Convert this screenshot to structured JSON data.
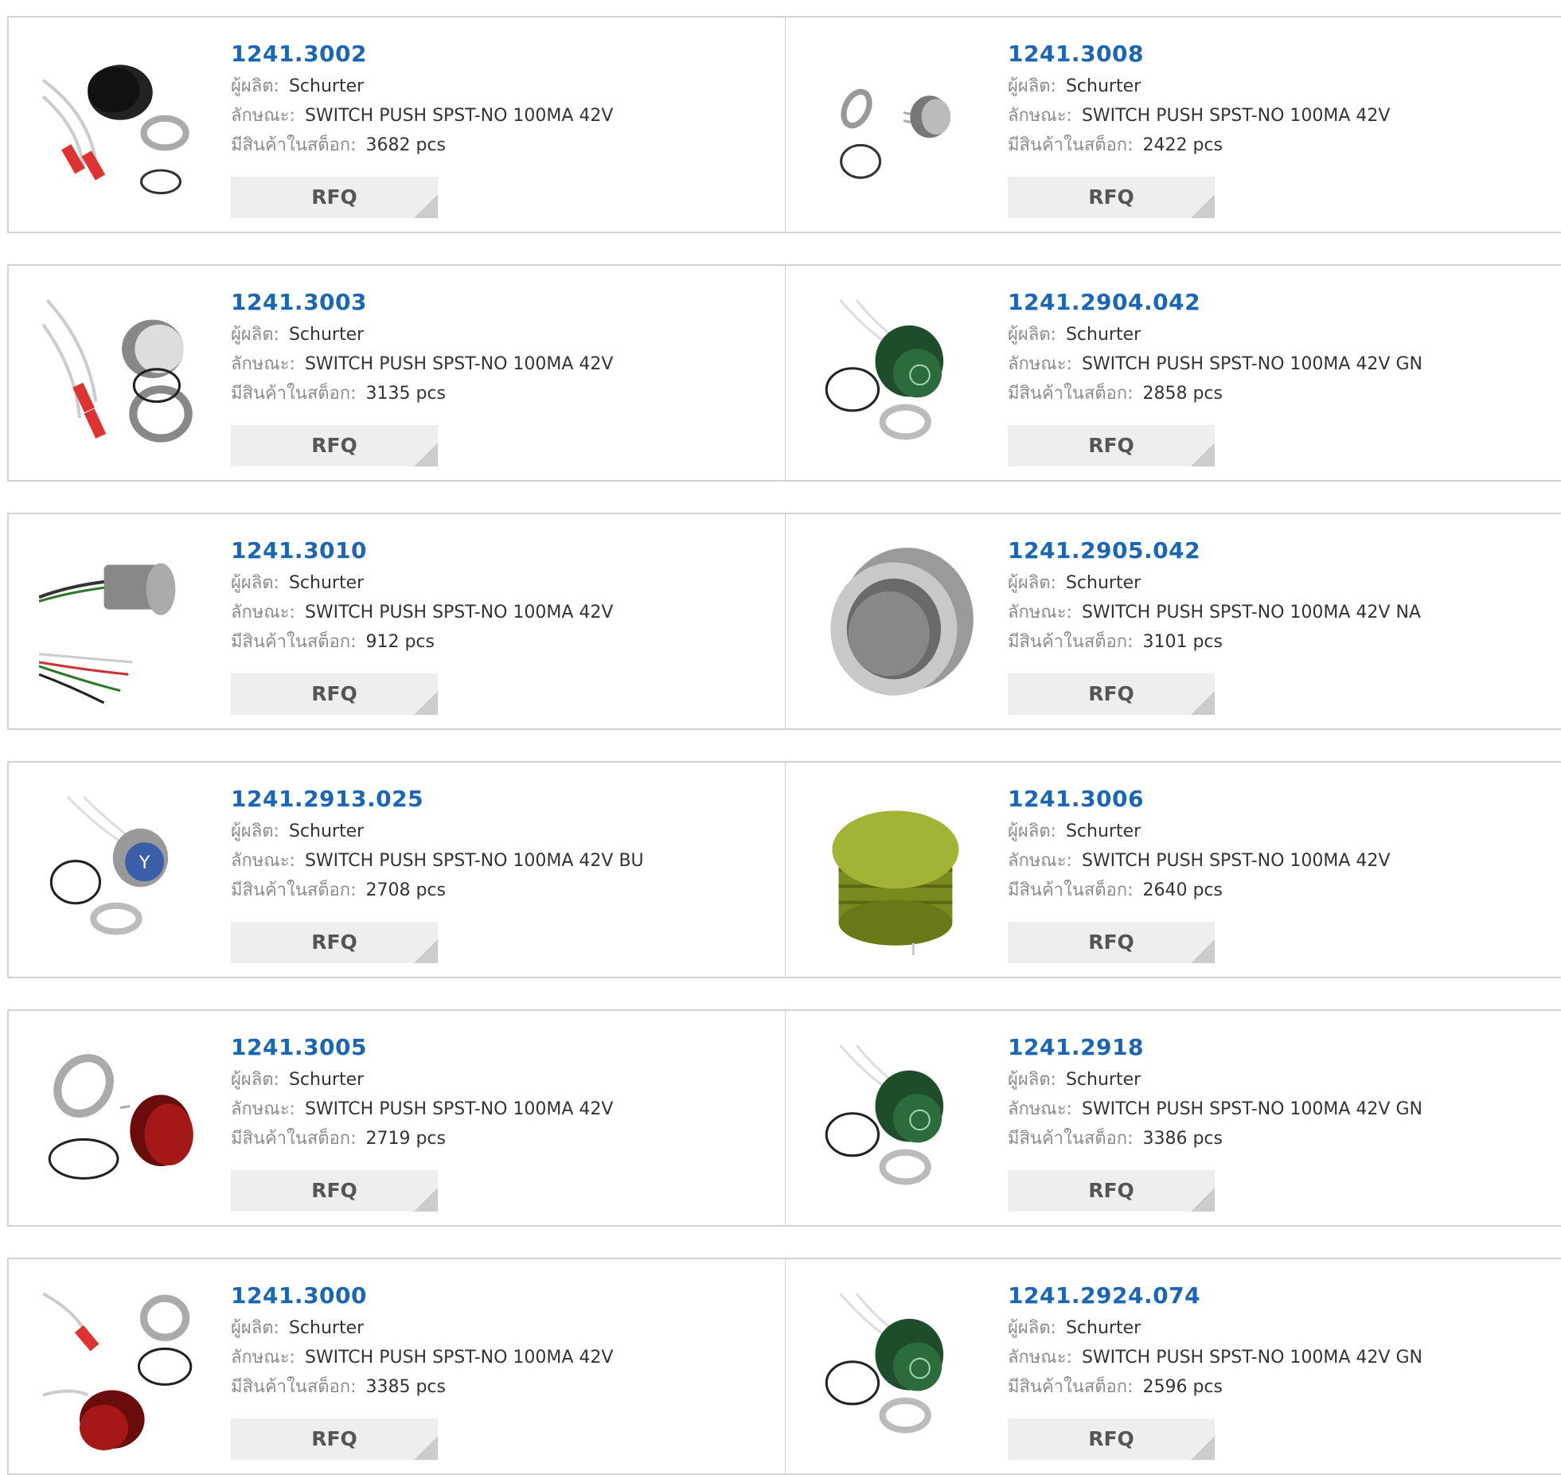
{
  "labels": {
    "manufacturer": "ผู้ผลิต:",
    "description": "ลักษณะ:",
    "stock": "มีสินค้าในสต็อก:",
    "rfq": "RFQ"
  },
  "rows": [
    [
      {
        "part": "1241.3002",
        "manufacturer": "Schurter",
        "description": "SWITCH PUSH SPST-NO 100MA 42V",
        "stock": "3682 pcs",
        "image_icon": "black-push-button-with-wires-icon"
      },
      {
        "part": "1241.3008",
        "manufacturer": "Schurter",
        "description": "SWITCH PUSH SPST-NO 100MA 42V",
        "stock": "2422 pcs",
        "image_icon": "small-steel-push-button-icon"
      }
    ],
    [
      {
        "part": "1241.3003",
        "manufacturer": "Schurter",
        "description": "SWITCH PUSH SPST-NO 100MA 42V",
        "stock": "3135 pcs",
        "image_icon": "silver-push-button-with-wires-icon"
      },
      {
        "part": "1241.2904.042",
        "manufacturer": "Schurter",
        "description": "SWITCH PUSH SPST-NO 100MA 42V GN",
        "stock": "2858 pcs",
        "image_icon": "green-power-push-button-icon"
      }
    ],
    [
      {
        "part": "1241.3010",
        "manufacturer": "Schurter",
        "description": "SWITCH PUSH SPST-NO 100MA 42V",
        "stock": "912 pcs",
        "image_icon": "steel-push-button-side-view-icon"
      },
      {
        "part": "1241.2905.042",
        "manufacturer": "Schurter",
        "description": "SWITCH PUSH SPST-NO 100MA 42V NA",
        "stock": "3101 pcs",
        "image_icon": "large-steel-push-button-icon"
      }
    ],
    [
      {
        "part": "1241.2913.025",
        "manufacturer": "Schurter",
        "description": "SWITCH PUSH SPST-NO 100MA 42V BU",
        "stock": "2708 pcs",
        "image_icon": "blue-symbol-push-button-icon"
      },
      {
        "part": "1241.3006",
        "manufacturer": "Schurter",
        "description": "SWITCH PUSH SPST-NO 100MA 42V",
        "stock": "2640 pcs",
        "image_icon": "olive-push-button-icon"
      }
    ],
    [
      {
        "part": "1241.3005",
        "manufacturer": "Schurter",
        "description": "SWITCH PUSH SPST-NO 100MA 42V",
        "stock": "2719 pcs",
        "image_icon": "red-push-button-icon"
      },
      {
        "part": "1241.2918",
        "manufacturer": "Schurter",
        "description": "SWITCH PUSH SPST-NO 100MA 42V GN",
        "stock": "3386 pcs",
        "image_icon": "green-power-push-button-icon"
      }
    ],
    [
      {
        "part": "1241.3000",
        "manufacturer": "Schurter",
        "description": "SWITCH PUSH SPST-NO 100MA 42V",
        "stock": "3385 pcs",
        "image_icon": "red-push-button-with-wires-icon"
      },
      {
        "part": "1241.2924.074",
        "manufacturer": "Schurter",
        "description": "SWITCH PUSH SPST-NO 100MA 42V GN",
        "stock": "2596 pcs",
        "image_icon": "green-power-push-button-icon"
      }
    ]
  ]
}
